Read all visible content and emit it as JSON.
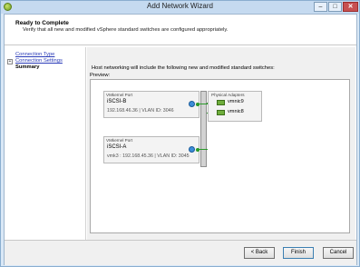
{
  "window": {
    "title": "Add Network Wizard"
  },
  "titlebar_buttons": {
    "minimize": "–",
    "maximize": "□",
    "close": "✕"
  },
  "header": {
    "title": "Ready to Complete",
    "subtitle": "Verify that all new and modified vSphere standard switches are configured appropriately."
  },
  "nav": {
    "items": [
      {
        "label": "Connection Type",
        "state": "link"
      },
      {
        "label": "Connection Settings",
        "state": "link",
        "expander": "+"
      },
      {
        "label": "Summary",
        "state": "current"
      }
    ]
  },
  "main": {
    "intro": "Host networking will include the following new and modified standard switches:",
    "preview_label": "Preview:"
  },
  "preview": {
    "portgroups": [
      {
        "header": "VMkernel Port",
        "name": "iSCSI-B",
        "detail": "192.168.46.36 | VLAN ID: 3046"
      },
      {
        "header": "VMkernel Port",
        "name": "iSCSI-A",
        "detail": "vmk3 : 192.168.45.36 | VLAN ID: 3045"
      }
    ],
    "adapters": {
      "header": "Physical Adapters",
      "items": [
        "vmnic9",
        "vmnic8"
      ]
    }
  },
  "footer": {
    "back": "< Back",
    "finish": "Finish",
    "cancel": "Cancel"
  },
  "colors": {
    "link": "#2a3bb8",
    "connector": "#2a9a2a",
    "titlebar": "#c5daf0",
    "close": "#c75050"
  }
}
